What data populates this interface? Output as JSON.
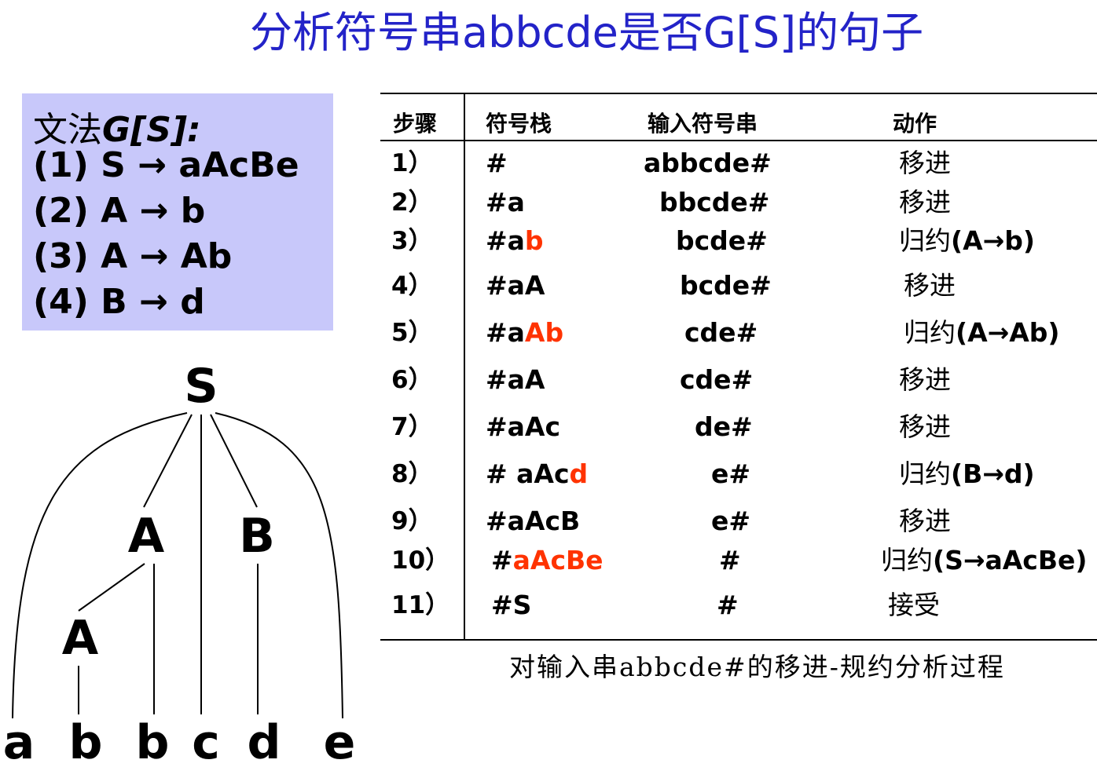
{
  "title": "分析符号串abbcde是否G[S]的句子",
  "grammar": {
    "heading_cn": "文法",
    "heading_en": "G[S]:",
    "rules": [
      "(1) S → aAcBe",
      "(2) A → b",
      "(3) A → Ab",
      "(4) B → d"
    ]
  },
  "tree": {
    "nodes": {
      "root": "S",
      "a_mid": "A",
      "b_mid": "B",
      "a_low": "A",
      "leaves": [
        "a",
        "b",
        "b",
        "c",
        "d",
        "e"
      ]
    }
  },
  "table": {
    "headers": {
      "step": "步骤",
      "stack": "符号栈",
      "input": "输入符号串",
      "action": "动作"
    },
    "rows": [
      {
        "step": "1）",
        "stack_pre": "#",
        "stack_red": "",
        "input": "abbcde#",
        "action_cn": "移进",
        "action_en": ""
      },
      {
        "step": "2）",
        "stack_pre": "#a",
        "stack_red": "",
        "input": "bbcde#",
        "action_cn": "移进",
        "action_en": ""
      },
      {
        "step": "3）",
        "stack_pre": "#a",
        "stack_red": "b",
        "input": "bcde#",
        "action_cn": "归约",
        "action_en": "(A→b)"
      },
      {
        "step": "4）",
        "stack_pre": "#aA",
        "stack_red": "",
        "input": "bcde#",
        "action_cn": "移进",
        "action_en": ""
      },
      {
        "step": "5）",
        "stack_pre": "#a",
        "stack_red": "Ab",
        "input": "cde#",
        "action_cn": "归约",
        "action_en": "(A→Ab)"
      },
      {
        "step": "6）",
        "stack_pre": "#aA",
        "stack_red": "",
        "input": "cde#",
        "action_cn": "移进",
        "action_en": ""
      },
      {
        "step": "7）",
        "stack_pre": "#aAc",
        "stack_red": "",
        "input": "de#",
        "action_cn": "移进",
        "action_en": ""
      },
      {
        "step": "8）",
        "stack_pre": "# aAc",
        "stack_red": "d",
        "input": "e#",
        "action_cn": "归约",
        "action_en": "(B→d)"
      },
      {
        "step": "9）",
        "stack_pre": "#aAcB",
        "stack_red": "",
        "input": "e#",
        "action_cn": "移进",
        "action_en": ""
      },
      {
        "step": "10）",
        "stack_pre": "#",
        "stack_red": "aAcBe",
        "input": "#",
        "action_cn": "归约",
        "action_en": "(S→aAcBe)"
      },
      {
        "step": "11）",
        "stack_pre": "#S",
        "stack_red": "",
        "input": "#",
        "action_cn": "接受",
        "action_en": ""
      }
    ]
  },
  "caption": "对输入串abbcde#的移进-规约分析过程",
  "colors": {
    "title": "#2323c8",
    "grammar_bg": "#c8c8fa",
    "highlight": "#ff3300"
  }
}
